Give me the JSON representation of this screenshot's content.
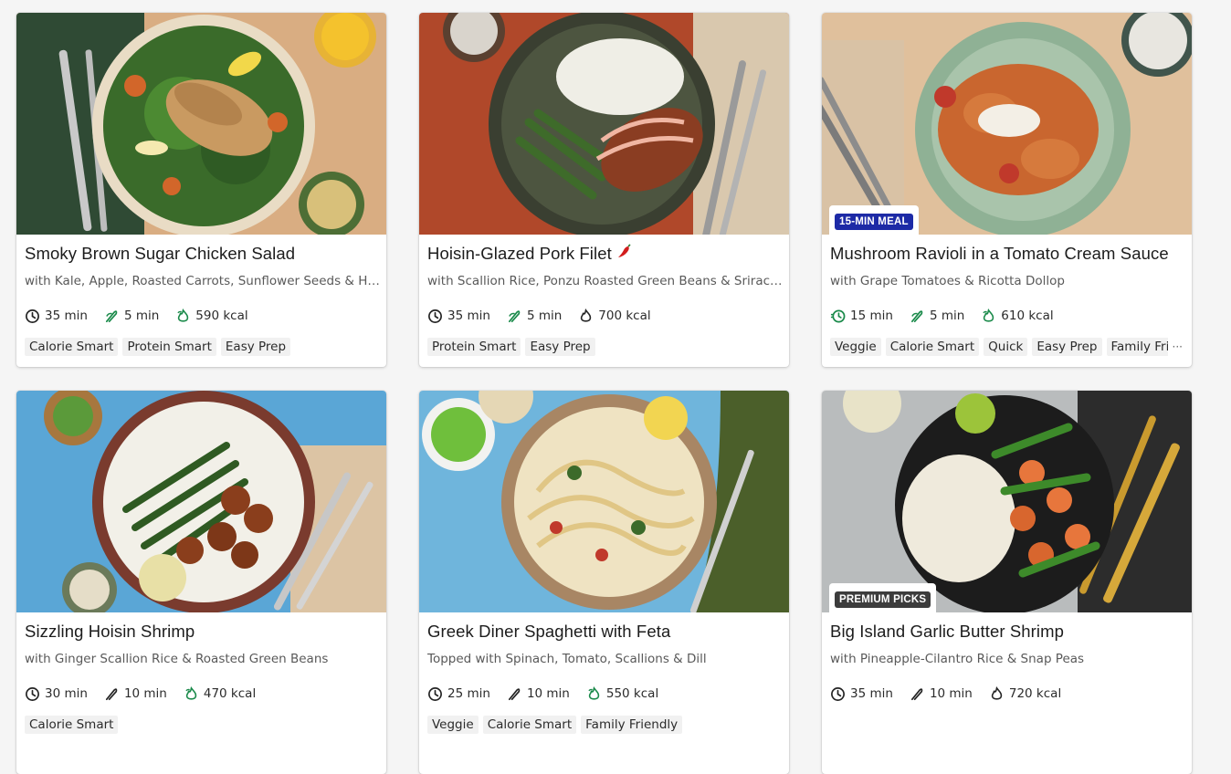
{
  "cards": [
    {
      "title": "Smoky Brown Sugar Chicken Salad",
      "subtitle": "with Kale, Apple, Roasted Carrots, Sunflower Seeds & Hon...",
      "time": "35 min",
      "prep": "5 min",
      "kcal": "590 kcal",
      "tags": [
        "Calorie Smart",
        "Protein Smart",
        "Easy Prep"
      ],
      "badge": null,
      "spicy": false,
      "kcal_icon": "leaf-flame-icon"
    },
    {
      "title": "Hoisin-Glazed Pork Filet",
      "subtitle": "with Scallion Rice, Ponzu Roasted Green Beans & Sriracha...",
      "time": "35 min",
      "prep": "5 min",
      "kcal": "700 kcal",
      "tags": [
        "Protein Smart",
        "Easy Prep"
      ],
      "badge": null,
      "spicy": true,
      "kcal_icon": "flame-icon"
    },
    {
      "title": "Mushroom Ravioli in a Tomato Cream Sauce",
      "subtitle": "with Grape Tomatoes & Ricotta Dollop",
      "time": "15 min",
      "prep": "5 min",
      "kcal": "610 kcal",
      "tags": [
        "Veggie",
        "Calorie Smart",
        "Quick",
        "Easy Prep",
        "Family Frie"
      ],
      "more": "···",
      "badge": "15-MIN MEAL",
      "spicy": false,
      "kcal_icon": "leaf-flame-icon"
    },
    {
      "title": "Sizzling Hoisin Shrimp",
      "subtitle": "with Ginger Scallion Rice & Roasted Green Beans",
      "time": "30 min",
      "prep": "10 min",
      "kcal": "470 kcal",
      "tags": [
        "Calorie Smart"
      ],
      "badge": null,
      "spicy": false,
      "kcal_icon": "leaf-flame-icon"
    },
    {
      "title": "Greek Diner Spaghetti with Feta",
      "subtitle": "Topped with Spinach, Tomato, Scallions & Dill",
      "time": "25 min",
      "prep": "10 min",
      "kcal": "550 kcal",
      "tags": [
        "Veggie",
        "Calorie Smart",
        "Family Friendly"
      ],
      "badge": null,
      "spicy": false,
      "kcal_icon": "leaf-flame-icon"
    },
    {
      "title": "Big Island Garlic Butter Shrimp",
      "subtitle": "with Pineapple-Cilantro Rice & Snap Peas",
      "time": "35 min",
      "prep": "10 min",
      "kcal": "720 kcal",
      "tags": [],
      "badge": "PREMIUM PICKS",
      "spicy": false,
      "kcal_icon": "flame-icon"
    }
  ],
  "colors": {
    "eco_green": "#1a8a4a",
    "badge_blue": "#1d2aa6",
    "badge_dark": "#3c3c3c"
  }
}
